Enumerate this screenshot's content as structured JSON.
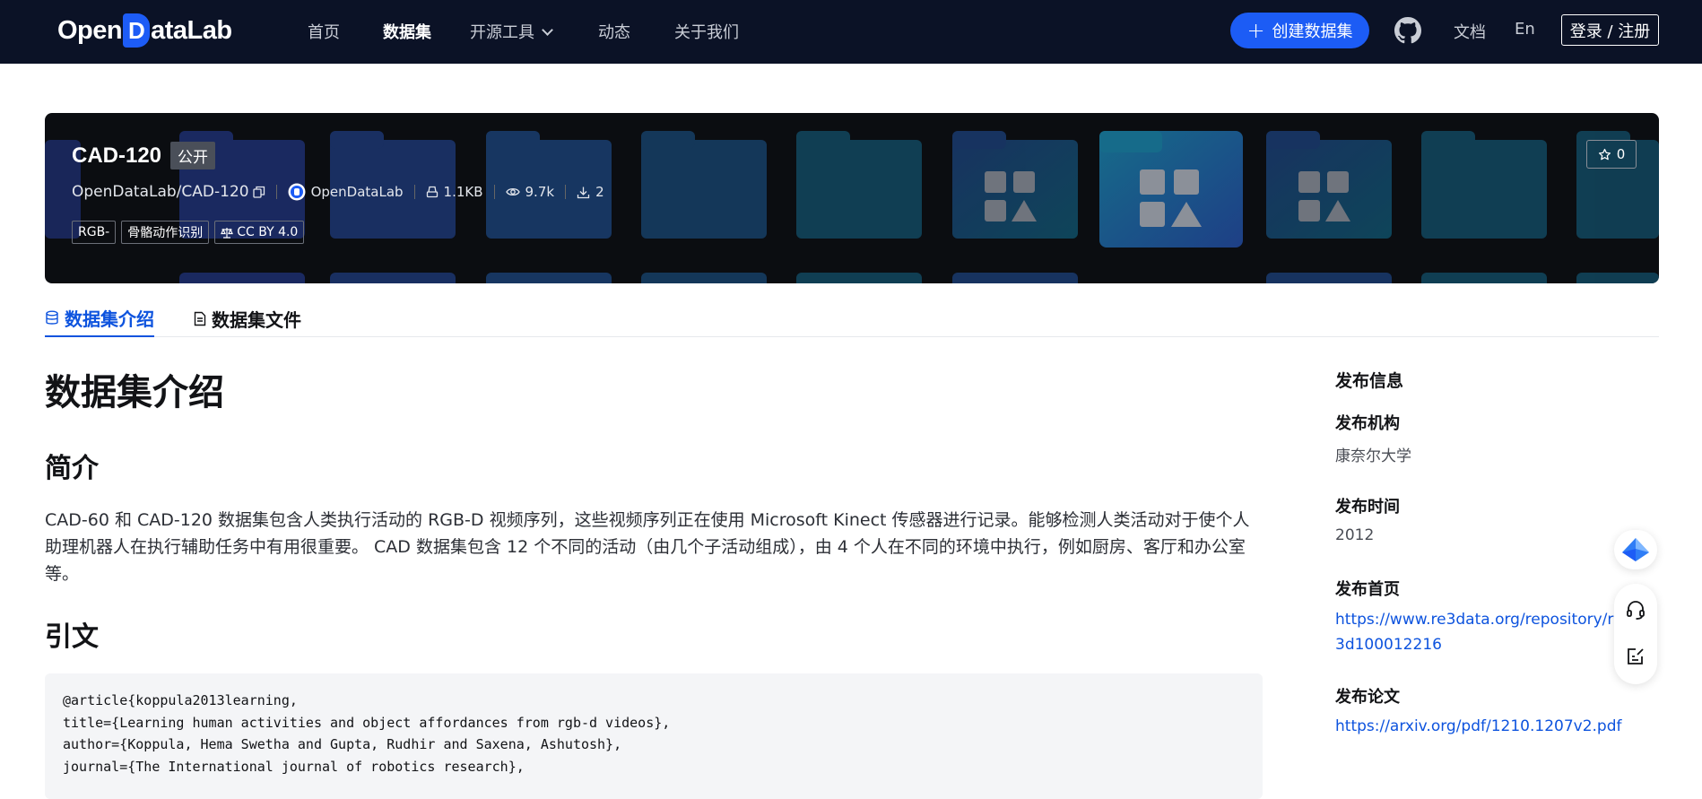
{
  "nav": {
    "logo_before": "Open",
    "logo_d": "D",
    "logo_after": "ataLab",
    "items": [
      {
        "label": "首页"
      },
      {
        "label": "数据集"
      },
      {
        "label": "开源工具"
      },
      {
        "label": "动态"
      },
      {
        "label": "关于我们"
      }
    ],
    "create_label": "创建数据集",
    "docs_label": "文档",
    "lang_label": "En",
    "login_label": "登录 / 注册"
  },
  "dataset": {
    "name": "CAD-120",
    "visibility": "公开",
    "path": "OpenDataLab/CAD-120",
    "publisher": "OpenDataLab",
    "size": "1.1KB",
    "views": "9.7k",
    "downloads": "2",
    "tags": [
      "RGB-",
      "骨骼动作识别",
      "CC BY 4.0"
    ],
    "stars": "0"
  },
  "tabs": [
    {
      "label": "数据集介绍",
      "icon": "database-icon"
    },
    {
      "label": "数据集文件",
      "icon": "file-icon"
    }
  ],
  "content": {
    "title": "数据集介绍",
    "intro_heading": "简介",
    "intro_text": "CAD-60 和 CAD-120 数据集包含人类执行活动的 RGB-D 视频序列，这些视频序列正在使用 Microsoft Kinect 传感器进行记录。能够检测人类活动对于使个人助理机器人在执行辅助任务中有用很重要。 CAD 数据集包含 12 个不同的活动（由几个子活动组成），由 4 个人在不同的环境中执行，例如厨房、客厅和办公室等。",
    "citation_heading": "引文",
    "citation_lines": [
      "@article{koppula2013learning,",
      "title={Learning human activities and object affordances from rgb-d videos},",
      "author={Koppula, Hema Swetha and Gupta, Rudhir and Saxena, Ashutosh},",
      "journal={The International journal of robotics research},"
    ]
  },
  "sidebar": {
    "heading": "发布信息",
    "org_label": "发布机构",
    "org_value": "康奈尔大学",
    "time_label": "发布时间",
    "time_value": "2012",
    "home_label": "发布首页",
    "home_value": "https://www.re3data.org/repository/r3d100012216",
    "paper_label": "发布论文",
    "paper_value": "https://arxiv.org/pdf/1210.1207v2.pdf"
  },
  "colors": {
    "nav_bg": "#0b1226",
    "accent": "#1c5cf5",
    "link": "#0d53de"
  }
}
